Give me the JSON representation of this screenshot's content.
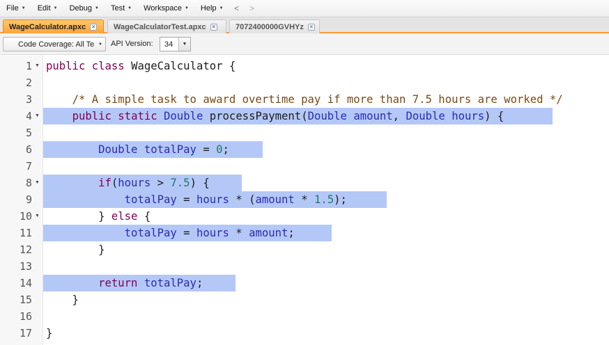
{
  "menu": {
    "items": [
      "File",
      "Edit",
      "Debug",
      "Test",
      "Workspace",
      "Help"
    ],
    "back_glyph": "<",
    "forward_glyph": ">"
  },
  "tabs": [
    {
      "label": "WageCalculator.apxc",
      "active": true
    },
    {
      "label": "WageCalculatorTest.apxc",
      "active": false
    },
    {
      "label": "7072400000GVHYz",
      "active": false
    }
  ],
  "tab_close_glyph": "×",
  "toolbar": {
    "coverage_value": "Code Coverage: All Te",
    "api_label": "API Version:",
    "api_value": "34"
  },
  "editor": {
    "line_numbers": [
      "1",
      "2",
      "3",
      "4",
      "5",
      "6",
      "7",
      "8",
      "9",
      "10",
      "11",
      "12",
      "13",
      "14",
      "15",
      "16",
      "17"
    ],
    "fold_lines": [
      "1",
      "4",
      "8",
      "10"
    ],
    "selected_lines": [
      "4",
      "6",
      "8",
      "9",
      "11",
      "14"
    ],
    "lines": [
      [
        [
          "kw",
          "public"
        ],
        [
          "pl",
          " "
        ],
        [
          "kw",
          "class"
        ],
        [
          "pl",
          " WageCalculator {"
        ]
      ],
      [],
      [
        [
          "pl",
          "    "
        ],
        [
          "cm",
          "/* A simple task to award overtime pay if more than 7.5 hours are worked */"
        ]
      ],
      [
        [
          "pl",
          "    "
        ],
        [
          "kw",
          "public"
        ],
        [
          "pl",
          " "
        ],
        [
          "kw",
          "static"
        ],
        [
          "pl",
          " "
        ],
        [
          "ty",
          "Double"
        ],
        [
          "pl",
          " processPayment("
        ],
        [
          "ty",
          "Double"
        ],
        [
          "pl",
          " "
        ],
        [
          "ty",
          "amount"
        ],
        [
          "pl",
          ", "
        ],
        [
          "ty",
          "Double"
        ],
        [
          "pl",
          " "
        ],
        [
          "ty",
          "hours"
        ],
        [
          "pl",
          ") {"
        ]
      ],
      [],
      [
        [
          "pl",
          "        "
        ],
        [
          "ty",
          "Double"
        ],
        [
          "pl",
          " "
        ],
        [
          "ty",
          "totalPay"
        ],
        [
          "pl",
          " = "
        ],
        [
          "num",
          "0"
        ],
        [
          "pl",
          ";"
        ]
      ],
      [],
      [
        [
          "pl",
          "        "
        ],
        [
          "kw",
          "if"
        ],
        [
          "pl",
          "("
        ],
        [
          "ty",
          "hours"
        ],
        [
          "pl",
          " > "
        ],
        [
          "num",
          "7.5"
        ],
        [
          "pl",
          ") {"
        ]
      ],
      [
        [
          "pl",
          "            "
        ],
        [
          "ty",
          "totalPay"
        ],
        [
          "pl",
          " = "
        ],
        [
          "ty",
          "hours"
        ],
        [
          "pl",
          " * ("
        ],
        [
          "ty",
          "amount"
        ],
        [
          "pl",
          " * "
        ],
        [
          "num",
          "1.5"
        ],
        [
          "pl",
          ");"
        ]
      ],
      [
        [
          "pl",
          "        } "
        ],
        [
          "kw",
          "else"
        ],
        [
          "pl",
          " {"
        ]
      ],
      [
        [
          "pl",
          "            "
        ],
        [
          "ty",
          "totalPay"
        ],
        [
          "pl",
          " = "
        ],
        [
          "ty",
          "hours"
        ],
        [
          "pl",
          " * "
        ],
        [
          "ty",
          "amount"
        ],
        [
          "pl",
          ";"
        ]
      ],
      [
        [
          "pl",
          "        }"
        ]
      ],
      [],
      [
        [
          "pl",
          "        "
        ],
        [
          "kw",
          "return"
        ],
        [
          "pl",
          " "
        ],
        [
          "ty",
          "totalPay"
        ],
        [
          "pl",
          ";"
        ]
      ],
      [
        [
          "pl",
          "    }"
        ]
      ],
      [],
      [
        [
          "pl",
          "}"
        ]
      ]
    ]
  }
}
